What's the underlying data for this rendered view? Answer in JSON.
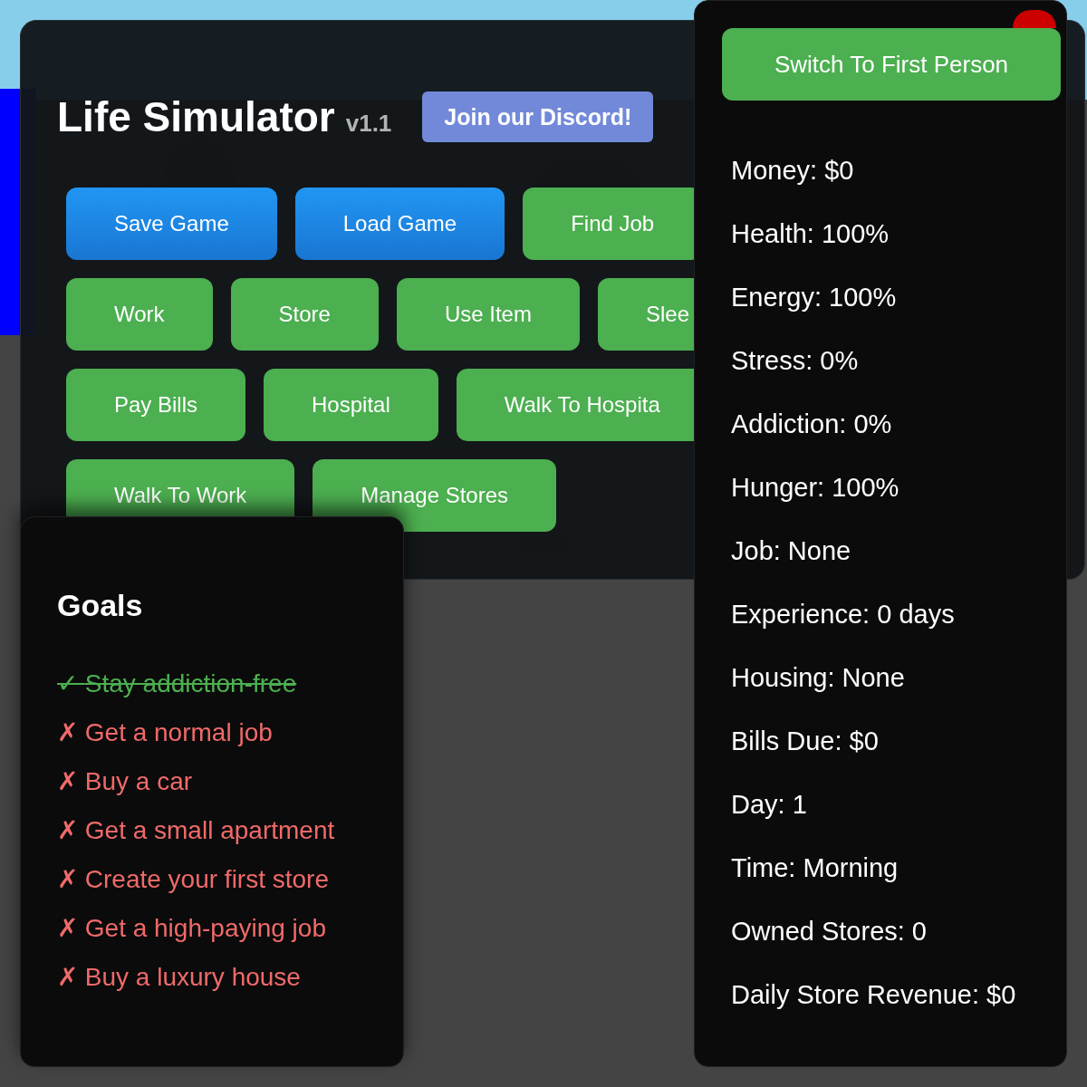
{
  "main_panel": {
    "title": "Life Simulator",
    "version": "v1.1",
    "discord_button": "Join our Discord!",
    "button_rows": [
      [
        {
          "label": "Save Game",
          "kind": "primary"
        },
        {
          "label": "Load Game",
          "kind": "primary"
        },
        {
          "label": "Find Job",
          "kind": "action"
        }
      ],
      [
        {
          "label": "Work",
          "kind": "action"
        },
        {
          "label": "Store",
          "kind": "action"
        },
        {
          "label": "Use Item",
          "kind": "action"
        },
        {
          "label": "Slee",
          "kind": "action"
        }
      ],
      [
        {
          "label": "Pay Bills",
          "kind": "action"
        },
        {
          "label": "Hospital",
          "kind": "action"
        },
        {
          "label": "Walk To Hospita",
          "kind": "action"
        }
      ],
      [
        {
          "label": "Walk To Work",
          "kind": "action"
        },
        {
          "label": "Manage Stores",
          "kind": "action"
        }
      ]
    ]
  },
  "goals_panel": {
    "title": "Goals",
    "goals": [
      {
        "mark": "✓",
        "text": "Stay addiction-free",
        "done": true
      },
      {
        "mark": "✗",
        "text": "Get a normal job",
        "done": false
      },
      {
        "mark": "✗",
        "text": "Buy a car",
        "done": false
      },
      {
        "mark": "✗",
        "text": "Get a small apartment",
        "done": false
      },
      {
        "mark": "✗",
        "text": "Create your first store",
        "done": false
      },
      {
        "mark": "✗",
        "text": "Get a high-paying job",
        "done": false
      },
      {
        "mark": "✗",
        "text": "Buy a luxury house",
        "done": false
      }
    ]
  },
  "stats_panel": {
    "switch_button": "Switch To First Person",
    "stats": [
      "Money: $0",
      "Health: 100%",
      "Energy: 100%",
      "Stress: 0%",
      "Addiction: 0%",
      "Hunger: 100%",
      "Job: None",
      "Experience: 0 days",
      "Housing: None",
      "Bills Due: $0",
      "Day: 1",
      "Time: Morning",
      "Owned Stores: 0",
      "Daily Store Revenue: $0"
    ]
  }
}
